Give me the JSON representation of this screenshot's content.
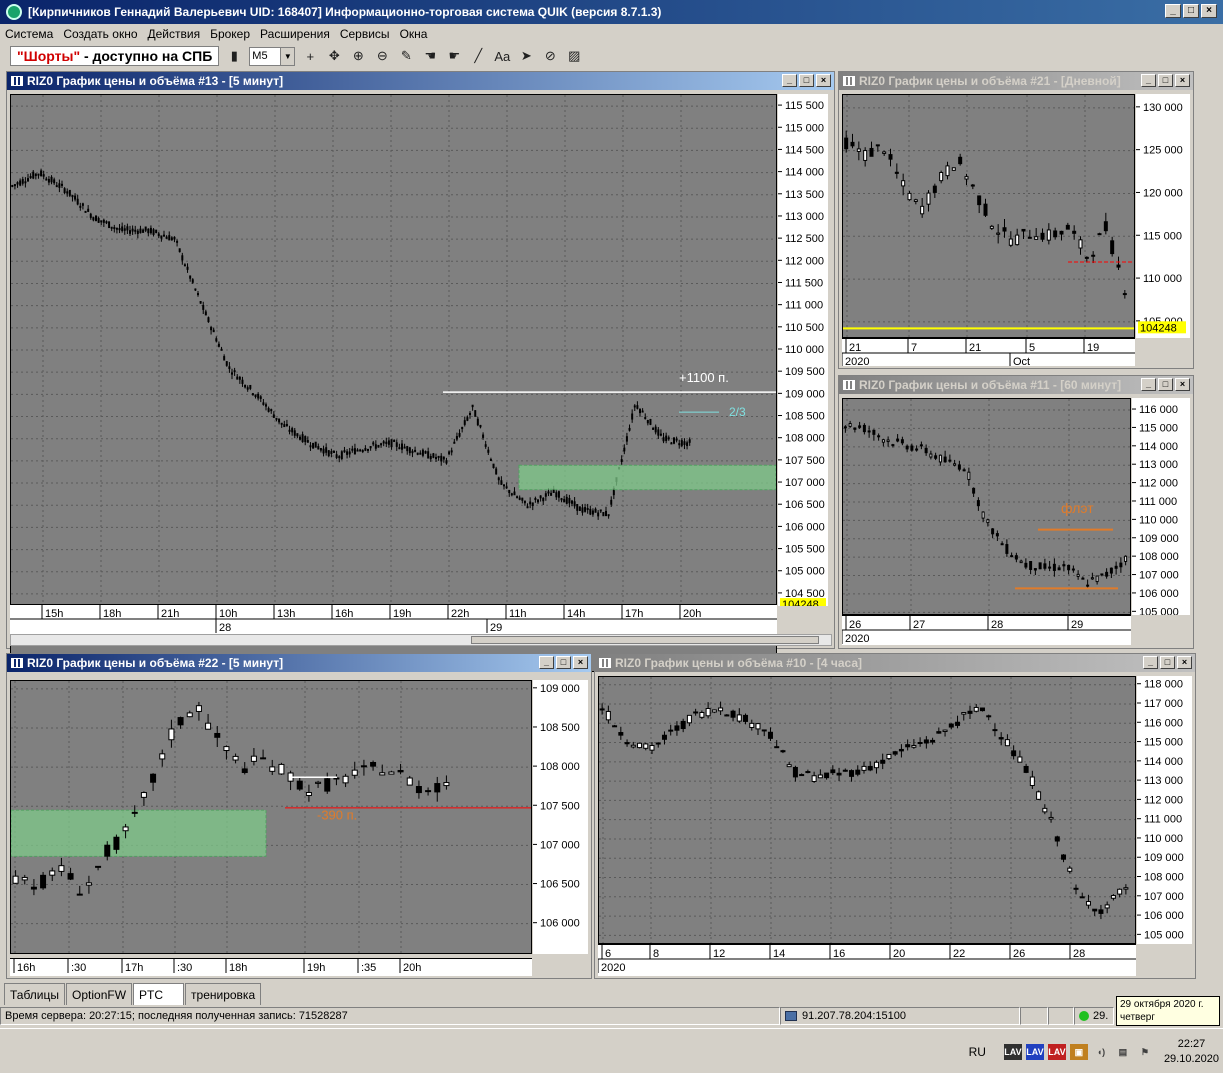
{
  "app": {
    "title": "[Кирпичников Геннадий Валерьевич UID: 168407] Информационно-торговая система QUIK (версия 8.7.1.3)"
  },
  "menu": [
    "Система",
    "Создать окно",
    "Действия",
    "Брокер",
    "Расширения",
    "Сервисы",
    "Окна"
  ],
  "toolbar": {
    "shorts_quote": "\"Шорты\"",
    "shorts_rest": " - доступно на СПБ",
    "timeframe": "M5"
  },
  "charts": {
    "c13": {
      "title": "RIZ0 График цены и объёма #13 - [5 минут]",
      "y_ticks": [
        "115 500",
        "115 000",
        "114 500",
        "114 000",
        "113 500",
        "113 000",
        "112 500",
        "112 000",
        "111 500",
        "111 000",
        "110 500",
        "110 000",
        "109 500",
        "109 000",
        "108 500",
        "108 000",
        "107 500",
        "107 000",
        "106 500",
        "106 000",
        "105 500",
        "105 000",
        "104 500"
      ],
      "price_label": "104248",
      "x_ticks": [
        "15h",
        "18h",
        "21h",
        "10h",
        "13h",
        "16h",
        "19h",
        "22h",
        "11h",
        "14h",
        "17h",
        "20h"
      ],
      "dates": [
        "28",
        "29"
      ],
      "annotation_level": "+1100 п.",
      "annotation_ratio": "2/3"
    },
    "c21": {
      "title": "RIZ0 График цены и объёма #21 - [Дневной]",
      "y_ticks": [
        "130 000",
        "125 000",
        "120 000",
        "115 000",
        "110 000",
        "105 000"
      ],
      "price_label": "104248",
      "x_ticks": [
        "21",
        "7",
        "21",
        "5",
        "19"
      ],
      "dates": [
        "2020",
        "Oct"
      ]
    },
    "c11": {
      "title": "RIZ0 График цены и объёма #11 - [60 минут]",
      "y_ticks": [
        "116 000",
        "115 000",
        "114 000",
        "113 000",
        "112 000",
        "111 000",
        "110 000",
        "109 000",
        "108 000",
        "107 000",
        "106 000",
        "105 000"
      ],
      "x_ticks": [
        "26",
        "27",
        "28",
        "29"
      ],
      "dates": [
        "2020"
      ],
      "annotation_flat": "флэт"
    },
    "c22": {
      "title": "RIZ0 График цены и объёма #22 - [5 минут]",
      "y_ticks": [
        "109 000",
        "108 500",
        "108 000",
        "107 500",
        "107 000",
        "106 500",
        "106 000"
      ],
      "x_ticks": [
        "16h",
        ":30",
        "17h",
        ":30",
        "18h",
        "19h",
        ":35",
        "20h"
      ],
      "annotation_loss": "-390 п."
    },
    "c10": {
      "title": "RIZ0 График цены и объёма #10 - [4 часа]",
      "y_ticks": [
        "118 000",
        "117 000",
        "116 000",
        "115 000",
        "114 000",
        "113 000",
        "112 000",
        "111 000",
        "110 000",
        "109 000",
        "108 000",
        "107 000",
        "106 000",
        "105 000"
      ],
      "x_ticks": [
        "6",
        "8",
        "12",
        "14",
        "16",
        "20",
        "22",
        "26",
        "28"
      ],
      "dates": [
        "2020"
      ]
    }
  },
  "tabs": [
    "Таблицы",
    "OptionFW",
    "PTC",
    "тренировка"
  ],
  "status": {
    "server_time": "Время сервера: 20:27:15; последняя полученная запись: 71528287",
    "address": "91.207.78.204:15100",
    "conn_short": "29."
  },
  "tooltip": {
    "line1": "29 октября 2020 г.",
    "line2": "четверг"
  },
  "taskbar": {
    "lang": "RU",
    "time": "22:27",
    "date": "29.10.2020"
  },
  "colors": {
    "plot_bg": "#808080",
    "price_line": "#ffff00",
    "zone": "#7fc98a",
    "annotation_orange": "#e07b2a",
    "annotation_cyan": "#7fe0e0",
    "stop_red": "#ff0000"
  }
}
